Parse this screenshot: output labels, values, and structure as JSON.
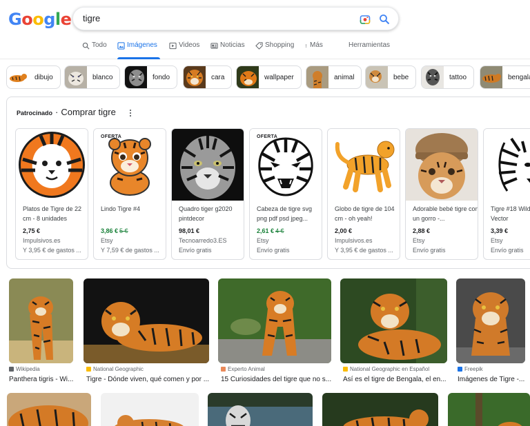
{
  "logo": {
    "letters": [
      "G",
      "o",
      "o",
      "g",
      "l",
      "e"
    ],
    "colors": [
      "#4285f4",
      "#ea4335",
      "#fbbc05",
      "#4285f4",
      "#34a853",
      "#ea4335"
    ]
  },
  "search": {
    "query": "tigre"
  },
  "tabs": [
    {
      "label": "Todo",
      "icon": "search-icon"
    },
    {
      "label": "Imágenes",
      "icon": "image-icon",
      "active": true
    },
    {
      "label": "Videos",
      "icon": "play-icon"
    },
    {
      "label": "Noticias",
      "icon": "news-icon"
    },
    {
      "label": "Shopping",
      "icon": "tag-icon"
    },
    {
      "label": "Más",
      "icon": "more-vert-icon"
    },
    {
      "label": "Herramientas",
      "icon": ""
    }
  ],
  "chips": [
    "dibujo",
    "blanco",
    "fondo",
    "cara",
    "wallpaper",
    "animal",
    "bebe",
    "tattoo",
    "bengala"
  ],
  "shopping": {
    "sponsored": "Patrocinado",
    "separator": "·",
    "title": "Comprar tigre",
    "cards": [
      {
        "title": "Platos de Tigre de 22 cm - 8 unidades",
        "price": "2,75 €",
        "old_price": "",
        "store": "Impulsivos.es",
        "shipping": "Y 3,95 € de gastos ...",
        "badge": ""
      },
      {
        "title": "Lindo Tigre #4",
        "price": "3,86 €",
        "old_price": "5 €",
        "store": "Etsy",
        "shipping": "Y 7,59 € de gastos ...",
        "badge": "OFERTA"
      },
      {
        "title": "Quadro tiger g2020 pintdecor",
        "price": "98,01 €",
        "old_price": "",
        "store": "Tecnoarredo3.ES",
        "shipping": "Envío gratis",
        "badge": ""
      },
      {
        "title": "Cabeza de tigre svg png pdf psd jpeg...",
        "price": "2,61 €",
        "old_price": "4 €",
        "store": "Etsy",
        "shipping": "Envío gratis",
        "badge": "OFERTA"
      },
      {
        "title": "Globo de tigre de 104 cm - oh yeah!",
        "price": "2,00 €",
        "old_price": "",
        "store": "Impulsivos.es",
        "shipping": "Y 3,95 € de gastos ...",
        "badge": ""
      },
      {
        "title": "Adorable bebé tigre con un gorro -...",
        "price": "2,88 €",
        "old_price": "",
        "store": "Etsy",
        "shipping": "Envío gratis",
        "badge": ""
      },
      {
        "title": "Tigre #18 Wild Graphic Vector",
        "price": "3,39 €",
        "old_price": "",
        "store": "Etsy",
        "shipping": "Envío gratis",
        "badge": ""
      }
    ]
  },
  "results": [
    {
      "source": "Wikipedia",
      "caption": "Panthera tigris - Wi...",
      "fav_color": "#5f6368"
    },
    {
      "source": "National Geographic",
      "caption": "Tigre - Dónde viven, qué comen y por ...",
      "fav_color": "#fbbc05"
    },
    {
      "source": "Experto Animal",
      "caption": "15 Curiosidades del tigre que no s...",
      "fav_color": "#ea8a5a"
    },
    {
      "source": "National Geographic en Español",
      "caption": "Así es el tigre de Bengala, el en...",
      "fav_color": "#fbbc05"
    },
    {
      "source": "Freepik",
      "caption": "Imágenes de Tigre -...",
      "fav_color": "#1a73e8"
    }
  ],
  "colors": {
    "accent": "#1a73e8",
    "sale": "#188038",
    "tiger": "#e0801e"
  }
}
